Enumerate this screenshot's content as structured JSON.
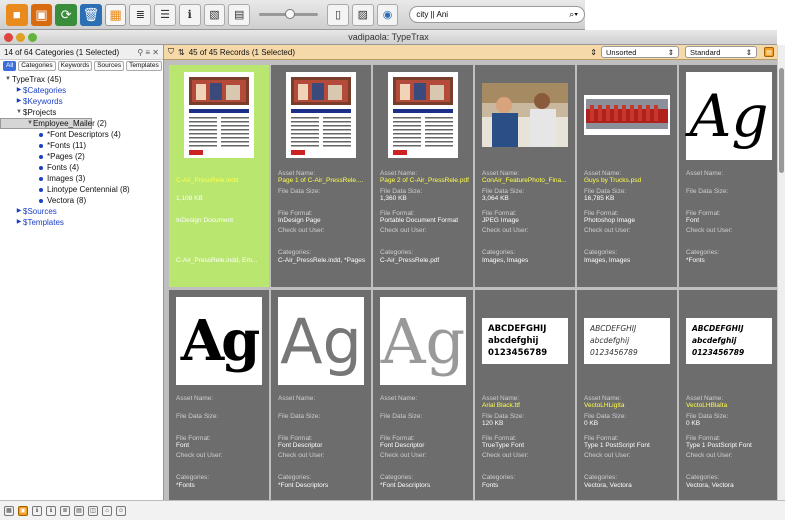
{
  "window": {
    "title": "vadipaola: TypeTrax"
  },
  "search": {
    "value": "city || Ani"
  },
  "sidebar": {
    "header": "14 of 64 Categories (1 Selected)",
    "tabs": [
      "All",
      "Categories",
      "Keywords",
      "Sources",
      "Templates"
    ],
    "tree": [
      {
        "label": "TypeTrax (45)",
        "level": 0,
        "toggle": "▼",
        "blue": false
      },
      {
        "label": "$Categories",
        "level": 1,
        "toggle": "▶",
        "blue": true
      },
      {
        "label": "$Keywords",
        "level": 1,
        "toggle": "▶",
        "blue": true
      },
      {
        "label": "$Projects",
        "level": 1,
        "toggle": "▼",
        "blue": false
      },
      {
        "label": "Employee_Mailer (2)",
        "level": 2,
        "toggle": "▼",
        "blue": false,
        "selected": true
      },
      {
        "label": "*Font Descriptors (4)",
        "level": 3,
        "toggle": "•",
        "blue": false
      },
      {
        "label": "*Fonts (11)",
        "level": 3,
        "toggle": "•",
        "blue": false
      },
      {
        "label": "*Pages (2)",
        "level": 3,
        "toggle": "•",
        "blue": false
      },
      {
        "label": "Fonts (4)",
        "level": 3,
        "toggle": "•",
        "blue": false
      },
      {
        "label": "Images (3)",
        "level": 3,
        "toggle": "•",
        "blue": false
      },
      {
        "label": "Linotype Centennial (8)",
        "level": 3,
        "toggle": "•",
        "blue": false
      },
      {
        "label": "Vectora (8)",
        "level": 3,
        "toggle": "•",
        "blue": false
      },
      {
        "label": "$Sources",
        "level": 1,
        "toggle": "▶",
        "blue": true
      },
      {
        "label": "$Templates",
        "level": 1,
        "toggle": "▶",
        "blue": true
      }
    ]
  },
  "records": {
    "count": "45 of 45 Records (1 Selected)",
    "sort": "Unsorted",
    "view": "Standard"
  },
  "labels": {
    "asset": "Asset Name:",
    "size": "File Data Size:",
    "format": "File Format:",
    "checkout": "Check out User:",
    "categories": "Categories:"
  },
  "cards": [
    {
      "thumb": "page",
      "name": "C-Air_PressRele.indd",
      "size": "1,108 KB",
      "format": "InDesign Document",
      "categories": "C-Air_PressRele.indd, Em...",
      "selected": true,
      "hideLabels": true
    },
    {
      "thumb": "page",
      "name": "Page 1 of C-Air_PressRele....",
      "size": "",
      "format": "InDesign Page",
      "categories": "C-Air_PressRele.indd, *Pages"
    },
    {
      "thumb": "page",
      "name": "Page 2 of C-Air_PressRele.pdf",
      "size": "1,360 KB",
      "format": "Portable Document Format",
      "categories": "C-Air_PressRele.pdf"
    },
    {
      "thumb": "photo",
      "name": "ConAir_FeaturePhoto_Fina...",
      "size": "3,064 KB",
      "format": "JPEG Image",
      "categories": "Images, Images"
    },
    {
      "thumb": "trucks",
      "name": "Guys by Trucks.psd",
      "size": "16,785 KB",
      "format": "Photoshop Image",
      "categories": "Images, Images"
    },
    {
      "thumb": "ag-serif",
      "text": "Ag",
      "name": "",
      "size": "",
      "format": "Font",
      "categories": "*Fonts"
    },
    {
      "thumb": "ag-bold",
      "text": "Ag",
      "name": "",
      "size": "",
      "format": "Font",
      "categories": "*Fonts"
    },
    {
      "thumb": "ag-gray",
      "text": "Ag",
      "name": "",
      "size": "",
      "format": "Font Descriptor",
      "categories": "*Font Descriptors"
    },
    {
      "thumb": "ag-light",
      "text": "Ag",
      "name": "",
      "size": "",
      "format": "Font Descriptor",
      "categories": "*Font Descriptors"
    },
    {
      "thumb": "alpha",
      "lines": [
        "ABCDEFGHIJ",
        "abcdefghij",
        "0123456789"
      ],
      "name": "Arial Black.ttf",
      "size": "120 KB",
      "format": "TrueType Font",
      "categories": "Fonts"
    },
    {
      "thumb": "alpha-ital",
      "lines": [
        "ABCDEFGHIJ",
        "abcdefghij",
        "0123456789"
      ],
      "name": "VectoLHLigIta",
      "size": "0 KB",
      "format": "Type 1 PostScript Font",
      "categories": "Vectora, Vectora"
    },
    {
      "thumb": "alpha-bi",
      "lines": [
        "ABCDEFGHIJ",
        "abcdefghij",
        "0123456789"
      ],
      "name": "VectoLHBlaIta",
      "size": "0 KB",
      "format": "Type 1 PostScript Font",
      "categories": "Vectora, Vectora"
    }
  ],
  "colors": {
    "selected_card": "#b8e66e",
    "card": "#6d6d6d",
    "highlight_text": "#ffff4c",
    "record_bar": "#f6d9a8"
  }
}
